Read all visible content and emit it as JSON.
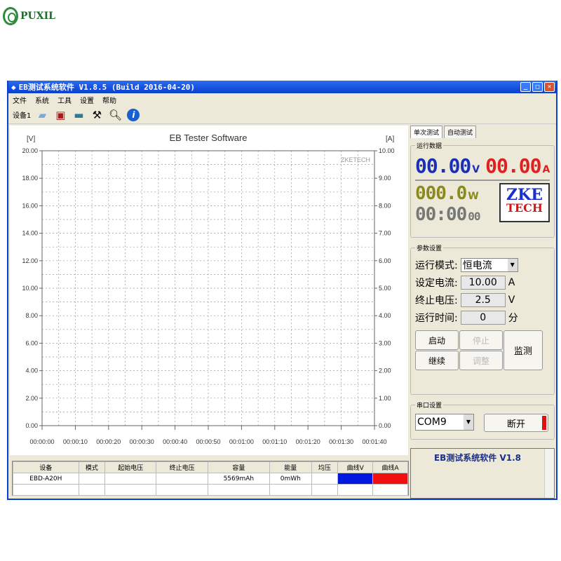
{
  "brand": "PUXIL",
  "window": {
    "title": "EB测试系统软件 V1.8.5 (Build 2016-04-20)"
  },
  "menu": [
    "文件",
    "系统",
    "工具",
    "设置",
    "帮助"
  ],
  "toolbar": {
    "device_label": "设备1"
  },
  "chart_data": {
    "type": "line",
    "title": "EB Tester Software",
    "watermark": "ZKETECH",
    "ylabel": "[V]",
    "y2label": "[A]",
    "ylim": [
      0,
      20
    ],
    "y2lim": [
      0,
      10
    ],
    "yticks": [
      "0.00",
      "2.00",
      "4.00",
      "6.00",
      "8.00",
      "10.00",
      "12.00",
      "14.00",
      "16.00",
      "18.00",
      "20.00"
    ],
    "y2ticks": [
      "0.00",
      "1.00",
      "2.00",
      "3.00",
      "4.00",
      "5.00",
      "6.00",
      "7.00",
      "8.00",
      "9.00",
      "10.00"
    ],
    "xticks": [
      "00:00:00",
      "00:00:10",
      "00:00:20",
      "00:00:30",
      "00:00:40",
      "00:00:50",
      "00:01:00",
      "00:01:10",
      "00:01:20",
      "00:01:30",
      "00:01:40"
    ],
    "series": [
      {
        "name": "曲线V",
        "color": "#0018e0",
        "values": []
      },
      {
        "name": "曲线A",
        "color": "#f01010",
        "values": []
      }
    ],
    "grid": true
  },
  "table": {
    "headers": [
      "设备",
      "模式",
      "起始电压",
      "终止电压",
      "容量",
      "能量",
      "均压",
      "曲线V",
      "曲线A"
    ],
    "rows": [
      [
        "EBD-A20H",
        "",
        "",
        "",
        "5569mAh",
        "0mWh",
        "",
        "",
        ""
      ]
    ]
  },
  "right": {
    "tabs": [
      "单次测试",
      "自动测试"
    ],
    "run_data_label": "运行数据",
    "voltage": "00.00",
    "voltage_unit": "V",
    "current": "00.00",
    "current_unit": "A",
    "power": "000.0",
    "power_unit": "W",
    "time": "00:00",
    "time_sec": "00",
    "logo_top": "ZKE",
    "logo_bottom": "TECH",
    "params_label": "参数设置",
    "mode_label": "运行模式:",
    "mode_value": "恒电流",
    "set_current_label": "设定电流:",
    "set_current": "10.00",
    "set_current_unit": "A",
    "end_voltage_label": "终止电压:",
    "end_voltage": "2.5",
    "end_voltage_unit": "V",
    "run_time_label": "运行时间:",
    "run_time": "0",
    "run_time_unit": "分",
    "buttons": {
      "start": "启动",
      "stop": "停止",
      "continue": "继续",
      "adjust": "调整",
      "monitor": "监测"
    },
    "serial_label": "串口设置",
    "port": "COM9",
    "disconnect": "断开",
    "info_text": "EB测试系统软件 V1.8"
  },
  "colors": {
    "voltage": "#1a2fb8",
    "current": "#e02020",
    "power": "#8a8a1a",
    "time": "#777777"
  }
}
